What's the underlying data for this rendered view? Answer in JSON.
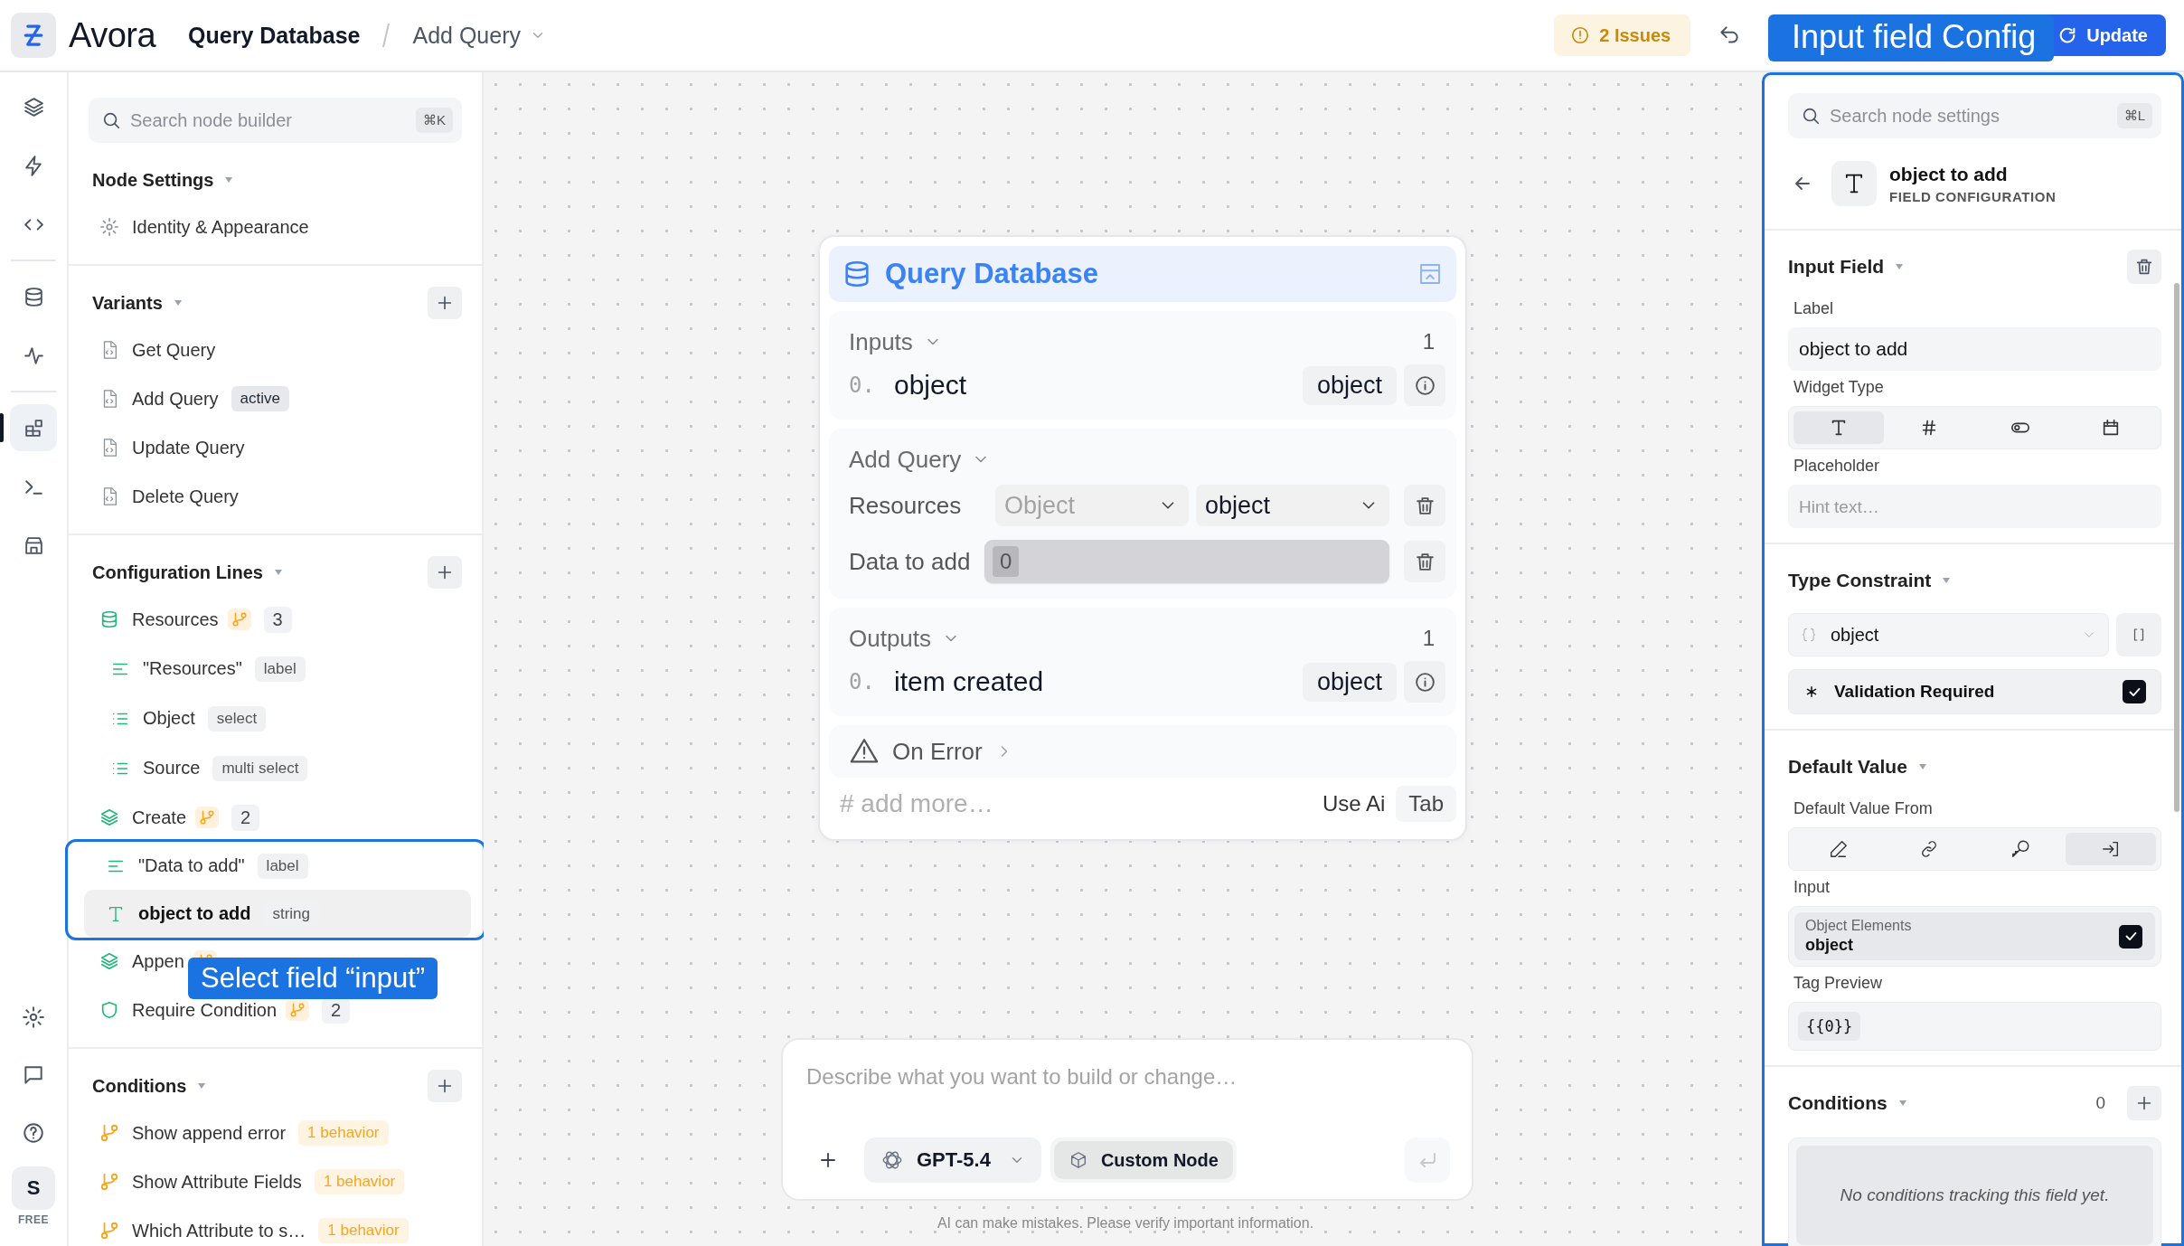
{
  "app": {
    "name": "Avora"
  },
  "breadcrumb": {
    "parent": "Query Database",
    "current": "Add Query"
  },
  "toolbar": {
    "issues": "2 Issues",
    "update": "Update"
  },
  "callouts": {
    "panel": "Input field Config",
    "field": "Select field “input”"
  },
  "rail": {
    "items": [
      {
        "selected": false
      },
      {
        "selected": false
      },
      {
        "selected": false
      },
      {
        "selected": false
      },
      {
        "selected": false
      },
      {
        "selected": true
      },
      {
        "selected": false
      },
      {
        "selected": false
      }
    ],
    "avatar": "S",
    "plan": "FREE"
  },
  "sidebar": {
    "search": {
      "placeholder": "Search node builder",
      "shortcut": "⌘K"
    },
    "node_settings": {
      "title": "Node Settings",
      "items": [
        {
          "label": "Identity & Appearance"
        }
      ]
    },
    "variants": {
      "title": "Variants",
      "items": [
        {
          "label": "Get Query"
        },
        {
          "label": "Add Query",
          "tag": "active"
        },
        {
          "label": "Update Query"
        },
        {
          "label": "Delete Query"
        }
      ]
    },
    "configuration_lines": {
      "title": "Configuration Lines",
      "items": [
        {
          "kind": "source",
          "label": "Resources",
          "branch": true,
          "count": "3",
          "children": [
            {
              "kind": "label",
              "label": "\"Resources\"",
              "tag": "label",
              "selected": false
            },
            {
              "kind": "select",
              "label": "Object",
              "tag": "select",
              "selected": false
            },
            {
              "kind": "select",
              "label": "Source",
              "tag": "multi select",
              "selected": false
            }
          ]
        },
        {
          "kind": "action",
          "label": "Create",
          "branch": true,
          "count": "2",
          "highlighted": true,
          "children": [
            {
              "kind": "label",
              "label": "\"Data to add\"",
              "tag": "label",
              "selected": false
            },
            {
              "kind": "text",
              "label": "object to add",
              "tag": "string",
              "selected": true
            }
          ]
        },
        {
          "kind": "action",
          "label": "Appen",
          "branch": true
        },
        {
          "kind": "rule",
          "label": "Require Condition",
          "branch": true,
          "count": "2"
        }
      ]
    },
    "conditions": {
      "title": "Conditions",
      "items": [
        {
          "label": "Show append error",
          "tag": "1 behavior"
        },
        {
          "label": "Show Attribute Fields",
          "tag": "1 behavior"
        },
        {
          "label": "Which Attribute to s…",
          "tag": "1 behavior"
        }
      ]
    }
  },
  "node": {
    "title": "Query Database",
    "inputs": {
      "title": "Inputs",
      "count": "1",
      "ports": [
        {
          "index": "0.",
          "name": "object",
          "type": "object"
        }
      ]
    },
    "query": {
      "title": "Add Query",
      "fields": [
        {
          "kind": "select",
          "label": "Resources",
          "options": [
            {
              "placeholder": "Object"
            },
            {
              "value": "object"
            }
          ]
        },
        {
          "kind": "tags",
          "label": "Data to add",
          "tags": [
            "0"
          ]
        }
      ]
    },
    "outputs": {
      "title": "Outputs",
      "count": "1",
      "ports": [
        {
          "index": "0.",
          "name": "item created",
          "type": "object"
        }
      ]
    },
    "on_error": {
      "title": "On Error"
    },
    "composer": {
      "placeholder": "# add more…",
      "hint": "Use Ai",
      "key": "Tab"
    }
  },
  "chat": {
    "placeholder": "Describe what you want to build or change…",
    "model": "GPT-5.4",
    "mode": "Custom Node",
    "disclaimer": "AI can make mistakes. Please verify important information."
  },
  "panel": {
    "search": {
      "placeholder": "Search node settings",
      "shortcut": "⌘L"
    },
    "title": "object to add",
    "subtitle": "FIELD CONFIGURATION",
    "input_field": {
      "title": "Input Field",
      "label_caption": "Label",
      "label_value": "object to add",
      "widget_caption": "Widget Type",
      "widgets": [
        {
          "selected": true
        },
        {
          "selected": false
        },
        {
          "selected": false
        },
        {
          "selected": false
        }
      ],
      "placeholder_caption": "Placeholder",
      "placeholder_hint": "Hint text…"
    },
    "type_constraint": {
      "title": "Type Constraint",
      "type": "object",
      "validation": {
        "label": "Validation Required",
        "checked": true
      }
    },
    "default_value": {
      "title": "Default Value",
      "from_caption": "Default Value From",
      "sources": [
        {
          "selected": false
        },
        {
          "selected": false
        },
        {
          "selected": false
        },
        {
          "selected": true
        }
      ],
      "input_caption": "Input",
      "input": {
        "caption": "Object Elements",
        "value": "object",
        "checked": true
      },
      "tag_caption": "Tag Preview",
      "tag": "{{0}}"
    },
    "conditions": {
      "title": "Conditions",
      "count": "0",
      "empty": "No conditions tracking this field yet."
    }
  }
}
